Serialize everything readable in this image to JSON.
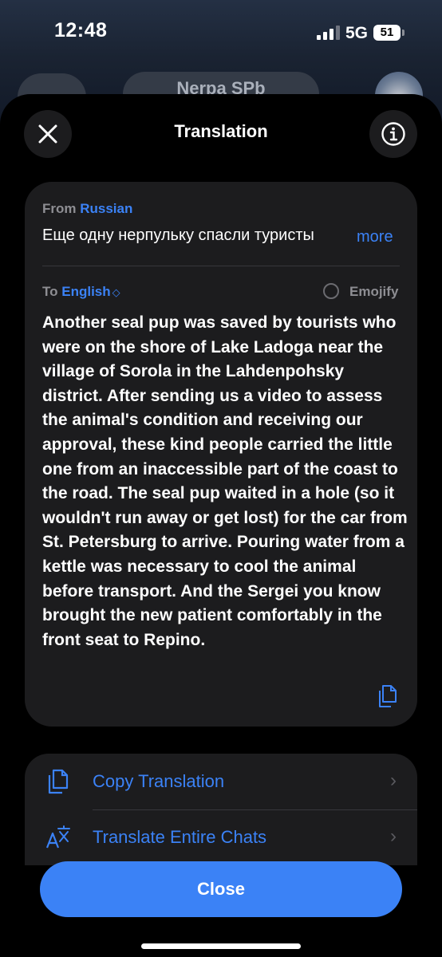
{
  "status_bar": {
    "time": "12:48",
    "network": "5G",
    "battery": "51"
  },
  "background_chat": {
    "title": "Nerpa SPb"
  },
  "sheet": {
    "title": "Translation",
    "close_icon": "close-icon",
    "info_icon": "info-icon"
  },
  "source": {
    "from_label": "From",
    "language": "Russian",
    "text": "Еще одну нерпульку спасли туристы",
    "more_label": "more"
  },
  "target": {
    "to_label": "To",
    "language": "English",
    "emojify_label": "Emojify",
    "emojify_checked": false,
    "text": "Another seal pup was saved by tourists who were on the shore of Lake Ladoga near the village of Sorola in the Lahdenpohsky district. After sending us a video to assess the animal's condition and receiving our approval, these kind people carried the little one from an inaccessible part of the coast to the road. The seal pup waited in a hole (so it wouldn't run away or get lost) for the car from St. Petersburg to arrive. Pouring water from a kettle was necessary to cool the animal before transport. And the Sergei you know brought the new patient comfortably in the front seat to Repino."
  },
  "actions": [
    {
      "label": "Copy Translation",
      "icon": "copy-icon"
    },
    {
      "label": "Translate Entire Chats",
      "icon": "translate-icon"
    }
  ],
  "close_button": {
    "label": "Close"
  },
  "colors": {
    "accent": "#3b82f6",
    "card": "#1c1c1e",
    "sheet": "#000000"
  }
}
